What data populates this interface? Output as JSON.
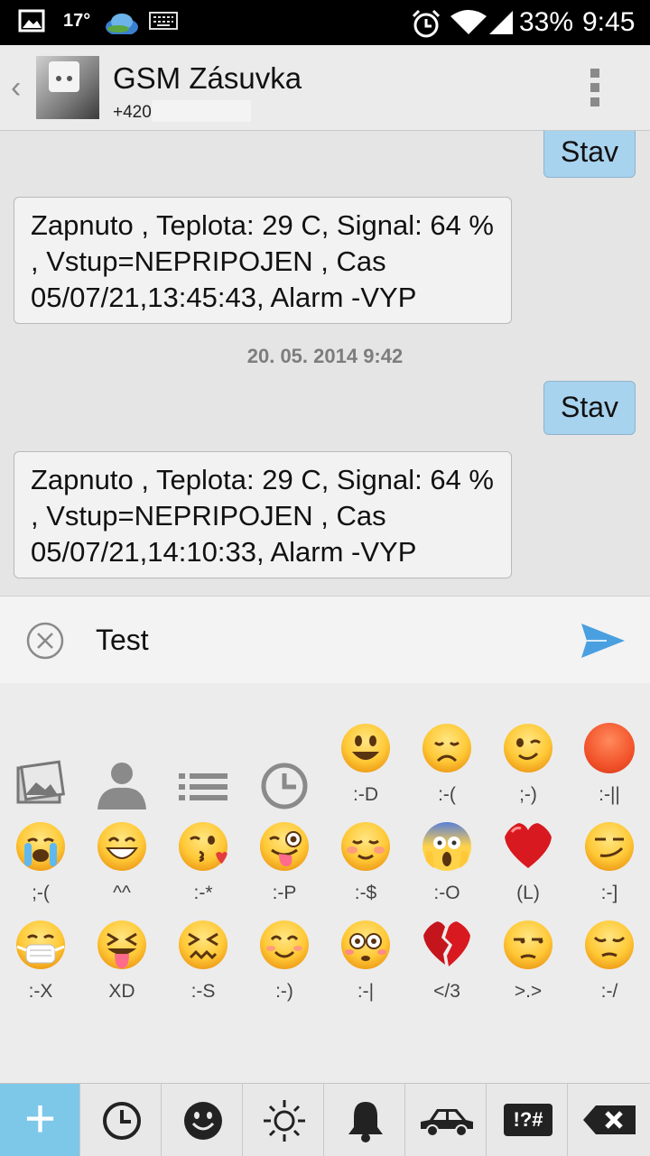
{
  "statusbar": {
    "temperature": "17°",
    "battery": "33%",
    "time": "9:45"
  },
  "header": {
    "back": "‹",
    "title": "GSM Zásuvka",
    "phone": "+420"
  },
  "messages": [
    {
      "type": "out",
      "text": "Stav"
    },
    {
      "type": "in",
      "text": "Zapnuto , Teplota: 29 C, Signal: 64 % , Vstup=NEPRIPOJEN , Cas 05/07/21,13:45:43, Alarm -VYP"
    },
    {
      "type": "timestamp",
      "text": "20. 05. 2014 9:42"
    },
    {
      "type": "out",
      "text": "Stav"
    },
    {
      "type": "in",
      "text": "Zapnuto , Teplota: 29 C, Signal: 64 % , Vstup=NEPRIPOJEN , Cas 05/07/21,14:10:33, Alarm -VYP"
    }
  ],
  "compose": {
    "value": "Test"
  },
  "emoji_rows": [
    [
      {
        "icon": "gallery-icon",
        "label": ""
      },
      {
        "icon": "contact-icon",
        "label": ""
      },
      {
        "icon": "list-icon",
        "label": ""
      },
      {
        "icon": "clock-icon",
        "label": ""
      },
      {
        "icon": "smile-emoji",
        "label": ":-D"
      },
      {
        "icon": "sad-emoji",
        "label": ":-("
      },
      {
        "icon": "wink-emoji",
        "label": ";-)"
      },
      {
        "icon": "angry-emoji",
        "label": ":-||"
      }
    ],
    [
      {
        "icon": "crying-emoji",
        "label": ";-("
      },
      {
        "icon": "grin-emoji",
        "label": "^^"
      },
      {
        "icon": "kiss-emoji",
        "label": ":-*"
      },
      {
        "icon": "tongue-emoji",
        "label": ":-P"
      },
      {
        "icon": "blush-emoji",
        "label": ":-$"
      },
      {
        "icon": "scream-emoji",
        "label": ":-O"
      },
      {
        "icon": "heart-emoji",
        "label": "(L)"
      },
      {
        "icon": "smirk-emoji",
        "label": ":-]"
      }
    ],
    [
      {
        "icon": "mask-emoji",
        "label": ":-X"
      },
      {
        "icon": "squint-tongue-emoji",
        "label": "XD"
      },
      {
        "icon": "confounded-emoji",
        "label": ":-S"
      },
      {
        "icon": "happy-emoji",
        "label": ":-)"
      },
      {
        "icon": "flushed-emoji",
        "label": ":-|"
      },
      {
        "icon": "broken-heart-emoji",
        "label": "</3"
      },
      {
        "icon": "unamused-emoji",
        "label": ">.>"
      },
      {
        "icon": "pensive-emoji",
        "label": ":-/"
      }
    ]
  ],
  "tabs": [
    {
      "icon": "plus-icon",
      "glyph": "+"
    },
    {
      "icon": "clock-tab-icon",
      "glyph": "◷"
    },
    {
      "icon": "smiley-tab-icon",
      "glyph": "☻"
    },
    {
      "icon": "sun-tab-icon",
      "glyph": "✹"
    },
    {
      "icon": "bell-tab-icon",
      "glyph": "🔔"
    },
    {
      "icon": "car-tab-icon",
      "glyph": "🚘"
    },
    {
      "icon": "symbols-tab-icon",
      "glyph": "!?#"
    },
    {
      "icon": "backspace-tab-icon",
      "glyph": "⌫"
    }
  ]
}
